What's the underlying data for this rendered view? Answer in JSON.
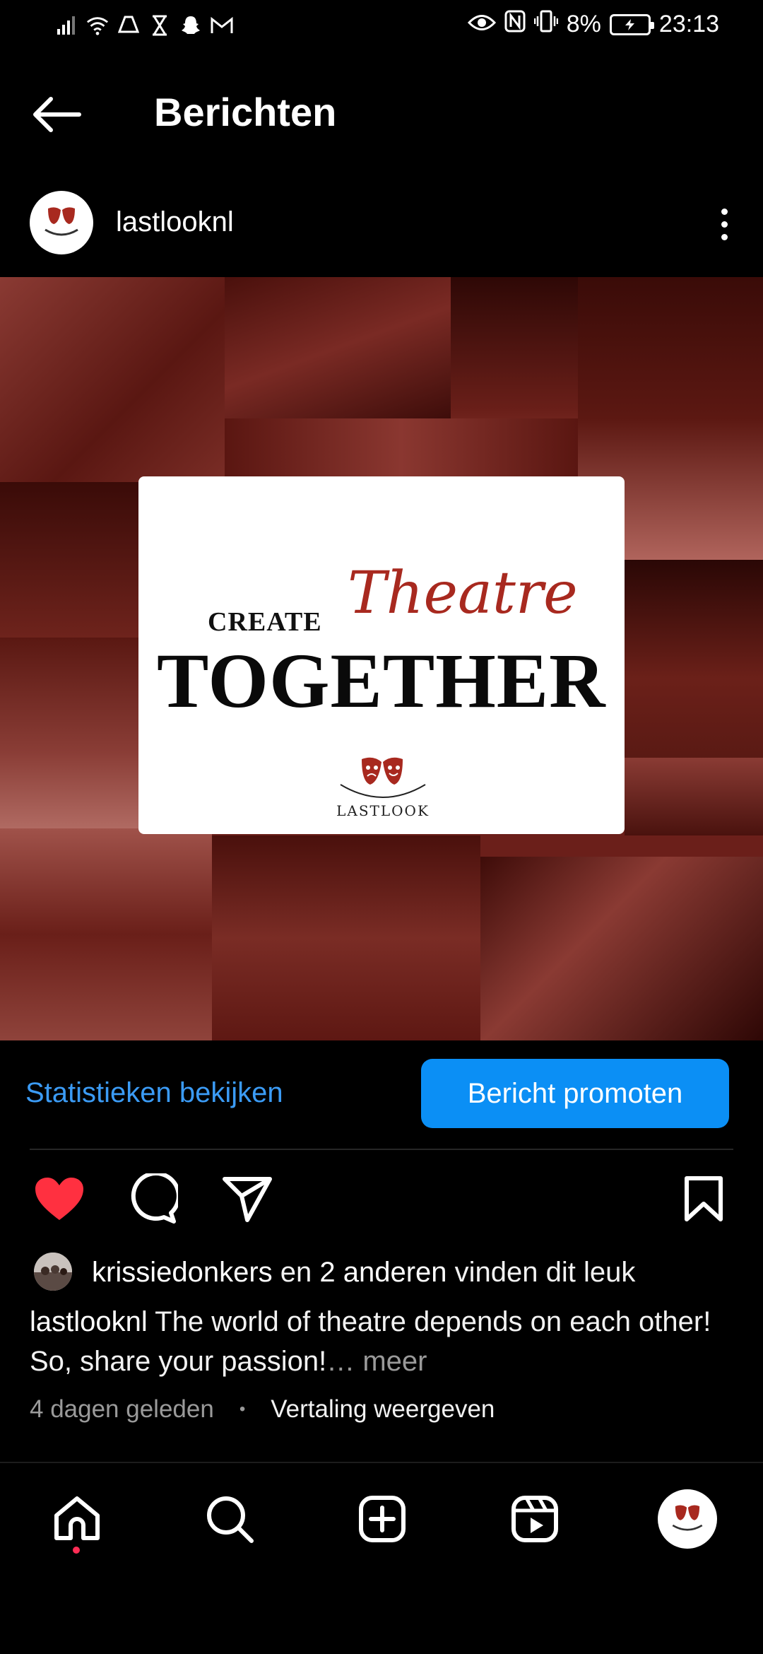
{
  "status_bar": {
    "battery_percent": "8%",
    "time": "23:13",
    "icons": [
      "signal-icon",
      "wifi-icon",
      "drive-icon",
      "hourglass-icon",
      "snapchat-icon",
      "gmail-icon",
      "eye-icon",
      "nfc-icon",
      "vibrate-icon",
      "battery-icon"
    ]
  },
  "header": {
    "title": "Berichten"
  },
  "post": {
    "username": "lastlooknl",
    "image": {
      "card_create": "CREATE",
      "card_theatre": "Theatre",
      "card_together": "TOGETHER",
      "logo_text": "LASTLOOK",
      "tint_color": "#6b1f1a"
    },
    "stats_link": "Statistieken bekijken",
    "promote_button": "Bericht promoten",
    "likes": {
      "user": "krissiedonkers",
      "connector": " en ",
      "others": "2 anderen",
      "suffix": " vinden dit leuk"
    },
    "caption": {
      "user": "lastlooknl",
      "text": " The world of theatre depends on each other! So, share your passion!",
      "ellipsis": "…",
      "more": " meer"
    },
    "time_ago": "4 dagen geleden",
    "dot": "•",
    "translate": "Vertaling weergeven",
    "liked": true
  },
  "colors": {
    "accent_blue": "#0b8ff5",
    "link_blue": "#3b9bf5",
    "heart_red": "#ff3040",
    "theatre_red": "#a8291f"
  }
}
